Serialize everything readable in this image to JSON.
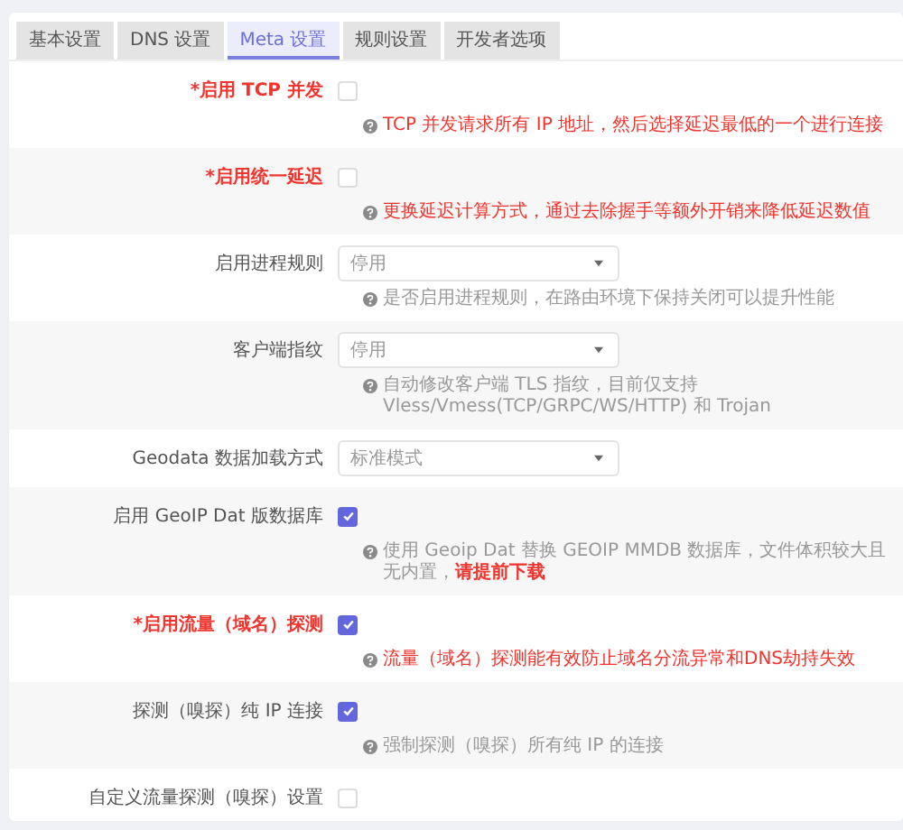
{
  "tabs": [
    {
      "label": "基本设置",
      "selected": false
    },
    {
      "label": "DNS 设置",
      "selected": false
    },
    {
      "label": "Meta 设置",
      "selected": true
    },
    {
      "label": "规则设置",
      "selected": false
    },
    {
      "label": "开发者选项",
      "selected": false
    }
  ],
  "settings": [
    {
      "kind": "checkbox",
      "label": "*启用 TCP 并发",
      "required": true,
      "checked": false,
      "hint": "TCP 并发请求所有 IP 地址，然后选择延迟最低的一个进行连接",
      "hint_warning": true
    },
    {
      "kind": "checkbox",
      "label": "*启用统一延迟",
      "required": true,
      "checked": false,
      "hint": "更换延迟计算方式，通过去除握手等额外开销来降低延迟数值",
      "hint_warning": true
    },
    {
      "kind": "select",
      "label": "启用进程规则",
      "required": false,
      "value": "停用",
      "hint": "是否启用进程规则，在路由环境下保持关闭可以提升性能",
      "hint_warning": false
    },
    {
      "kind": "select",
      "label": "客户端指纹",
      "required": false,
      "value": "停用",
      "hint": "自动修改客户端 TLS 指纹，目前仅支持 Vless/Vmess(TCP/GRPC/WS/HTTP) 和 Trojan",
      "hint_warning": false
    },
    {
      "kind": "select",
      "label": "Geodata 数据加载方式",
      "required": false,
      "value": "标准模式"
    },
    {
      "kind": "checkbox",
      "label": "启用 GeoIP Dat 版数据库",
      "required": false,
      "checked": true,
      "hint": "使用 Geoip Dat 替换 GEOIP MMDB 数据库，文件体积较大且无内置，",
      "hint_warning": false,
      "hint_link": "请提前下载"
    },
    {
      "kind": "checkbox",
      "label": "*启用流量（域名）探测",
      "required": true,
      "checked": true,
      "hint": "流量（域名）探测能有效防止域名分流异常和DNS劫持失效",
      "hint_warning": true
    },
    {
      "kind": "checkbox",
      "label": "探测（嗅探）纯 IP 连接",
      "required": false,
      "checked": true,
      "hint": "强制探测（嗅探）所有纯 IP 的连接",
      "hint_warning": false
    },
    {
      "kind": "checkbox",
      "label": "自定义流量探测（嗅探）设置",
      "required": false,
      "checked": false
    }
  ]
}
